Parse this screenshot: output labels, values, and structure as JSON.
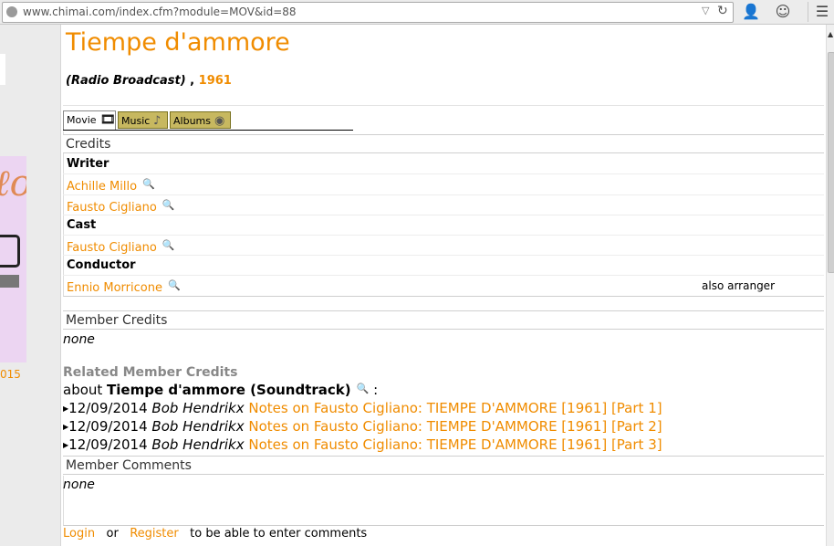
{
  "browser": {
    "url": "www.chimai.com/index.cfm?module=MOV&id=88"
  },
  "sidebar": {
    "year_fragment": "015"
  },
  "page": {
    "title": "Tiempe d'ammore",
    "subtitle_type": "(Radio Broadcast)",
    "subtitle_sep": " , ",
    "subtitle_year": "1961"
  },
  "tabs": [
    {
      "label": "Movie",
      "icon": "film-icon"
    },
    {
      "label": "Music",
      "icon": "music-note-icon"
    },
    {
      "label": "Albums",
      "icon": "disc-icon"
    }
  ],
  "credits": {
    "heading": "Credits",
    "writer_label": "Writer",
    "writers": [
      "Achille Millo",
      "Fausto Cigliano"
    ],
    "cast_label": "Cast",
    "cast": [
      "Fausto Cigliano"
    ],
    "conductor_label": "Conductor",
    "conductors": [
      "Ennio Morricone"
    ],
    "conductor_note": "also arranger"
  },
  "member_credits": {
    "heading": "Member Credits",
    "value": "none"
  },
  "related": {
    "heading": "Related Member Credits",
    "about_prefix": "about ",
    "about_title": "Tiempe d'ammore (Soundtrack)",
    "about_suffix": " :",
    "entries": [
      {
        "date": "12/09/2014",
        "author": "Bob Hendrikx",
        "link": "Notes on Fausto Cigliano: TIEMPE D'AMMORE [1961] [Part 1]"
      },
      {
        "date": "12/09/2014",
        "author": "Bob Hendrikx",
        "link": "Notes on Fausto Cigliano: TIEMPE D'AMMORE [1961] [Part 2]"
      },
      {
        "date": "12/09/2014",
        "author": "Bob Hendrikx",
        "link": "Notes on Fausto Cigliano: TIEMPE D'AMMORE [1961] [Part 3]"
      }
    ]
  },
  "member_comments": {
    "heading": "Member Comments",
    "value": "none"
  },
  "footer": {
    "login": "Login",
    "or": "or",
    "register": "Register",
    "tail": "to be able to enter comments"
  },
  "colors": {
    "accent": "#f08c00",
    "tab_inactive": "#c7b860"
  }
}
